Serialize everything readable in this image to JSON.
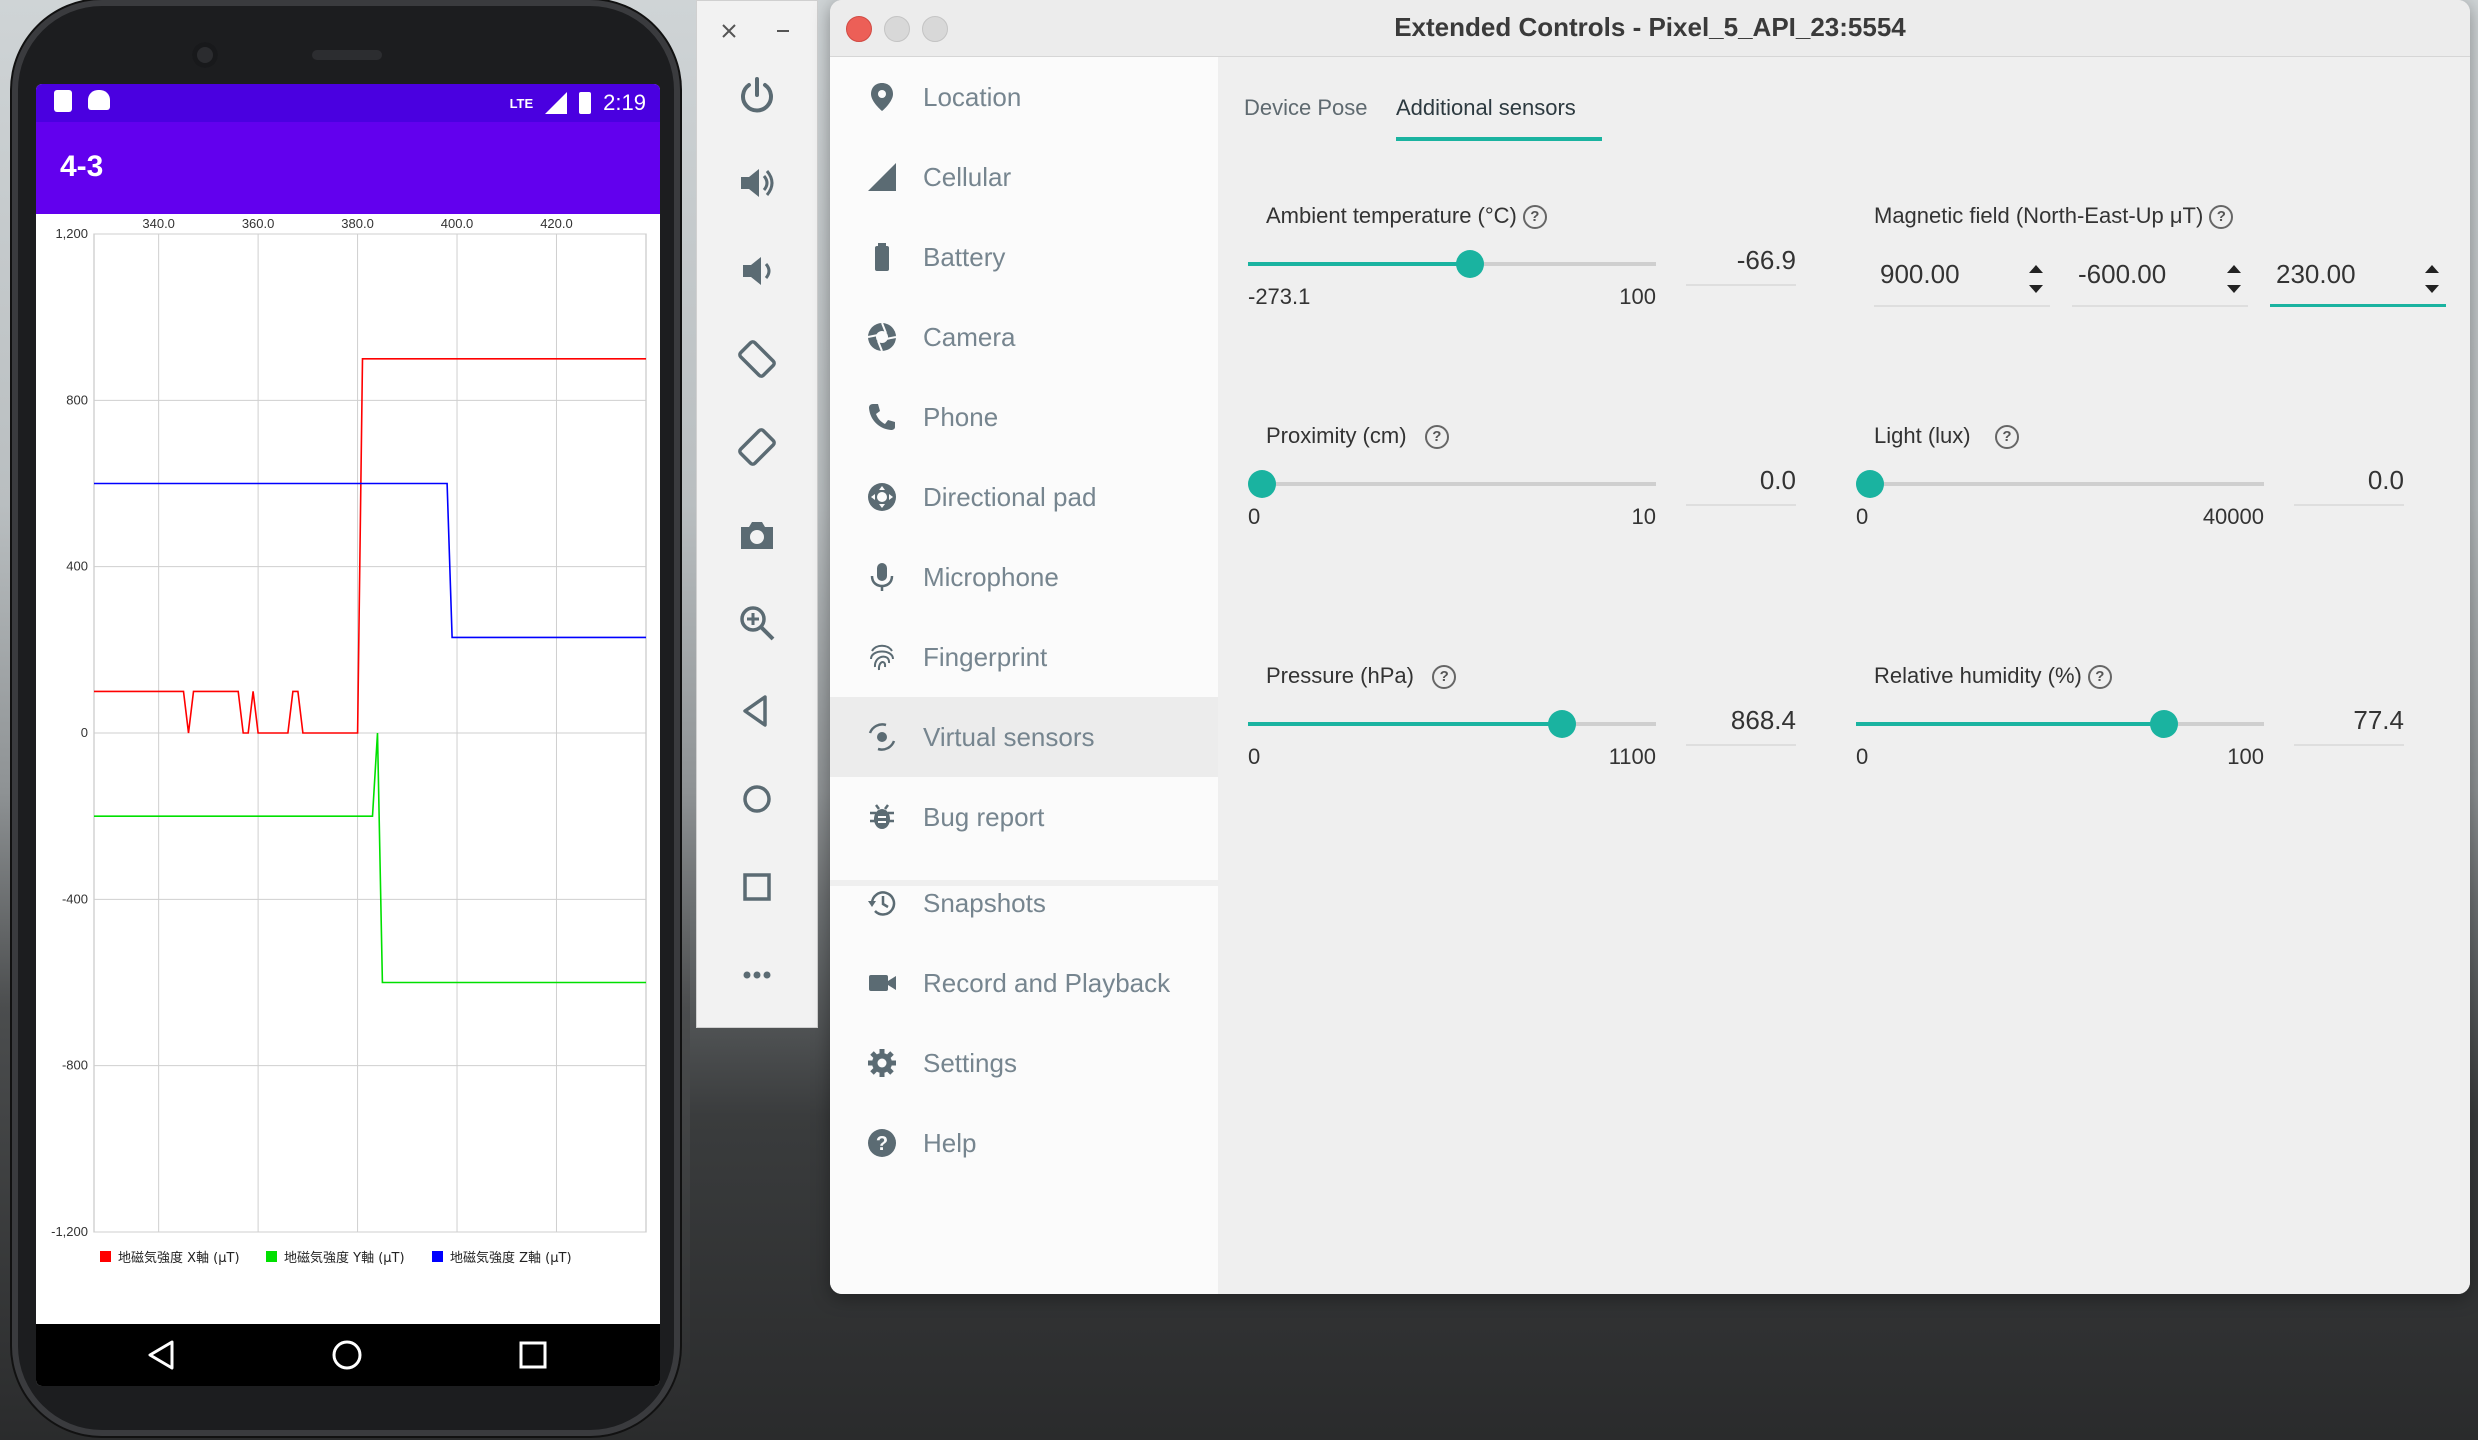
{
  "phone": {
    "status_time": "2:19",
    "status_network": "LTE",
    "app_title": "4-3",
    "nav": {
      "back": "back-icon",
      "home": "home-icon",
      "recents": "recents-icon"
    }
  },
  "chart_data": {
    "type": "line",
    "title": "",
    "xlabel": "",
    "ylabel": "",
    "xlim": [
      327,
      438
    ],
    "ylim": [
      -1200,
      1200
    ],
    "x_ticks": [
      "340.0",
      "360.0",
      "380.0",
      "400.0",
      "420.0"
    ],
    "y_ticks": [
      "1,200",
      "800",
      "400",
      "0",
      "-400",
      "-800",
      "-1,200"
    ],
    "grid": true,
    "legend_position": "bottom",
    "series": [
      {
        "name": "地磁気強度 X軸 (μT)",
        "color": "#ff0000",
        "x": [
          327,
          345,
          346,
          347,
          350,
          356,
          357,
          358,
          359,
          360,
          361,
          363,
          366,
          367,
          368,
          369,
          380,
          381,
          382,
          383,
          394,
          395,
          396,
          400,
          438
        ],
        "y": [
          100,
          100,
          0,
          100,
          100,
          100,
          0,
          0,
          100,
          0,
          0,
          0,
          0,
          100,
          100,
          0,
          0,
          900,
          900,
          900,
          900,
          900,
          900,
          900,
          900
        ]
      },
      {
        "name": "地磁気強度 Y軸 (μT)",
        "color": "#00e000",
        "x": [
          327,
          356,
          383,
          384,
          385,
          386,
          438
        ],
        "y": [
          -200,
          -200,
          -200,
          0,
          -600,
          -600,
          -600
        ]
      },
      {
        "name": "地磁気強度 Z軸 (μT)",
        "color": "#0000ff",
        "x": [
          327,
          362,
          398,
          399,
          400,
          438
        ],
        "y": [
          600,
          600,
          600,
          230,
          230,
          230
        ]
      }
    ]
  },
  "toolbar": {
    "close": "close-icon",
    "minimize": "minimize-icon",
    "buttons": [
      "power-icon",
      "volume-up-icon",
      "volume-down-icon",
      "rotate-left-icon",
      "rotate-right-icon",
      "camera-icon",
      "zoom-icon",
      "back-icon",
      "home-icon",
      "overview-icon",
      "more-icon"
    ]
  },
  "window": {
    "title": "Extended Controls - Pixel_5_API_23:5554",
    "nav": [
      {
        "label": "Location",
        "icon": "location-pin-icon"
      },
      {
        "label": "Cellular",
        "icon": "signal-icon"
      },
      {
        "label": "Battery",
        "icon": "battery-icon"
      },
      {
        "label": "Camera",
        "icon": "aperture-icon"
      },
      {
        "label": "Phone",
        "icon": "phone-icon"
      },
      {
        "label": "Directional pad",
        "icon": "dpad-icon"
      },
      {
        "label": "Microphone",
        "icon": "microphone-icon"
      },
      {
        "label": "Fingerprint",
        "icon": "fingerprint-icon"
      },
      {
        "label": "Virtual sensors",
        "icon": "virtual-sensors-icon"
      },
      {
        "label": "Bug report",
        "icon": "bug-icon"
      },
      {
        "label": "Snapshots",
        "icon": "history-icon"
      },
      {
        "label": "Record and Playback",
        "icon": "video-camera-icon"
      },
      {
        "label": "Settings",
        "icon": "gear-icon"
      },
      {
        "label": "Help",
        "icon": "help-icon"
      }
    ],
    "active_nav": "Virtual sensors",
    "tabs": [
      "Device Pose",
      "Additional sensors"
    ],
    "active_tab": "Additional sensors",
    "sensors": {
      "ambient_temperature": {
        "label": "Ambient temperature (°C)",
        "min": "-273.1",
        "max": "100",
        "value": "-66.9"
      },
      "magnetic_field": {
        "label": "Magnetic field (North-East-Up μT)",
        "north": "900.00",
        "east": "-600.00",
        "up": "230.00"
      },
      "proximity": {
        "label": "Proximity (cm)",
        "min": "0",
        "max": "10",
        "value": "0.0"
      },
      "light": {
        "label": "Light (lux)",
        "min": "0",
        "max": "40000",
        "value": "0.0"
      },
      "pressure": {
        "label": "Pressure (hPa)",
        "min": "0",
        "max": "1100",
        "value": "868.4"
      },
      "humidity": {
        "label": "Relative humidity (%)",
        "min": "0",
        "max": "100",
        "value": "77.4"
      }
    },
    "accent_color": "#1ab3a0"
  }
}
